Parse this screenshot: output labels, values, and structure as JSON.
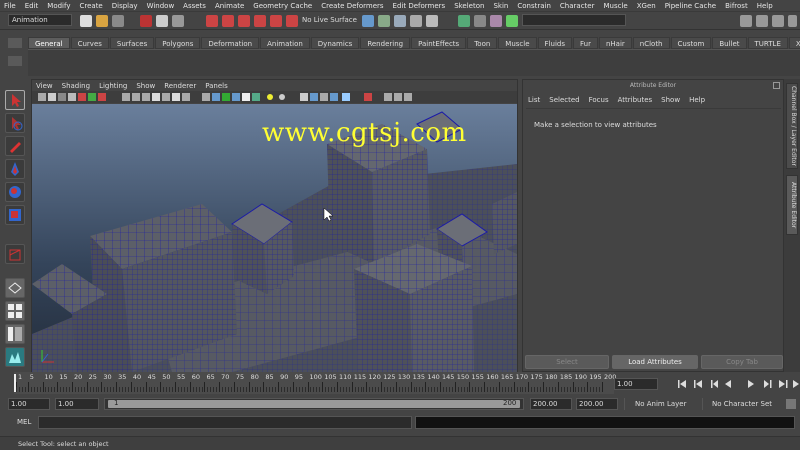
{
  "menubar": [
    "File",
    "Edit",
    "Modify",
    "Create",
    "Display",
    "Window",
    "Assets",
    "Animate",
    "Geometry Cache",
    "Create Deformers",
    "Edit Deformers",
    "Skeleton",
    "Skin",
    "Constrain",
    "Character",
    "Muscle",
    "XGen",
    "Pipeline Cache",
    "Bifrost",
    "Help"
  ],
  "status": {
    "mode": "Animation",
    "live_surface": "No Live Surface"
  },
  "shelf_tabs": [
    "General",
    "Curves",
    "Surfaces",
    "Polygons",
    "Deformation",
    "Animation",
    "Dynamics",
    "Rendering",
    "PaintEffects",
    "Toon",
    "Muscle",
    "Fluids",
    "Fur",
    "nHair",
    "nCloth",
    "Custom",
    "Bullet",
    "TURTLE",
    "XGen"
  ],
  "shelf_active": "General",
  "viewport": {
    "menu": [
      "View",
      "Shading",
      "Lighting",
      "Show",
      "Renderer",
      "Panels"
    ]
  },
  "watermark": "www.cgtsj.com",
  "attr_editor": {
    "title": "Attribute Editor",
    "menu": [
      "List",
      "Selected",
      "Focus",
      "Attributes",
      "Show",
      "Help"
    ],
    "message": "Make a selection to view attributes",
    "select_btn": "Select",
    "load_btn": "Load Attributes",
    "copy_btn": "Copy Tab"
  },
  "side_tabs": {
    "channel": "Channel Box / Layer Editor",
    "attribute": "Attribute Editor"
  },
  "timeline": {
    "ticks": [
      "1",
      "5",
      "10",
      "15",
      "20",
      "25",
      "30",
      "35",
      "40",
      "45",
      "50",
      "55",
      "60",
      "65",
      "70",
      "75",
      "80",
      "85",
      "90",
      "95",
      "100",
      "105",
      "110",
      "115",
      "120",
      "125",
      "130",
      "135",
      "140",
      "145",
      "150",
      "155",
      "160",
      "165",
      "170",
      "175",
      "180",
      "185",
      "190",
      "195",
      "200"
    ],
    "current_frame": "1.00"
  },
  "range": {
    "start": "1.00",
    "playback_start": "1.00",
    "slider_start": "1",
    "slider_end": "200",
    "playback_end": "200.00",
    "end": "200.00",
    "anim_layer": "No Anim Layer",
    "character": "No Character Set"
  },
  "cmd": {
    "label": "MEL"
  },
  "help_line": "Select Tool: select an object",
  "colors": {
    "bg": "#444444",
    "wire": "#1a1aa8",
    "watermark": "#ffff33"
  }
}
